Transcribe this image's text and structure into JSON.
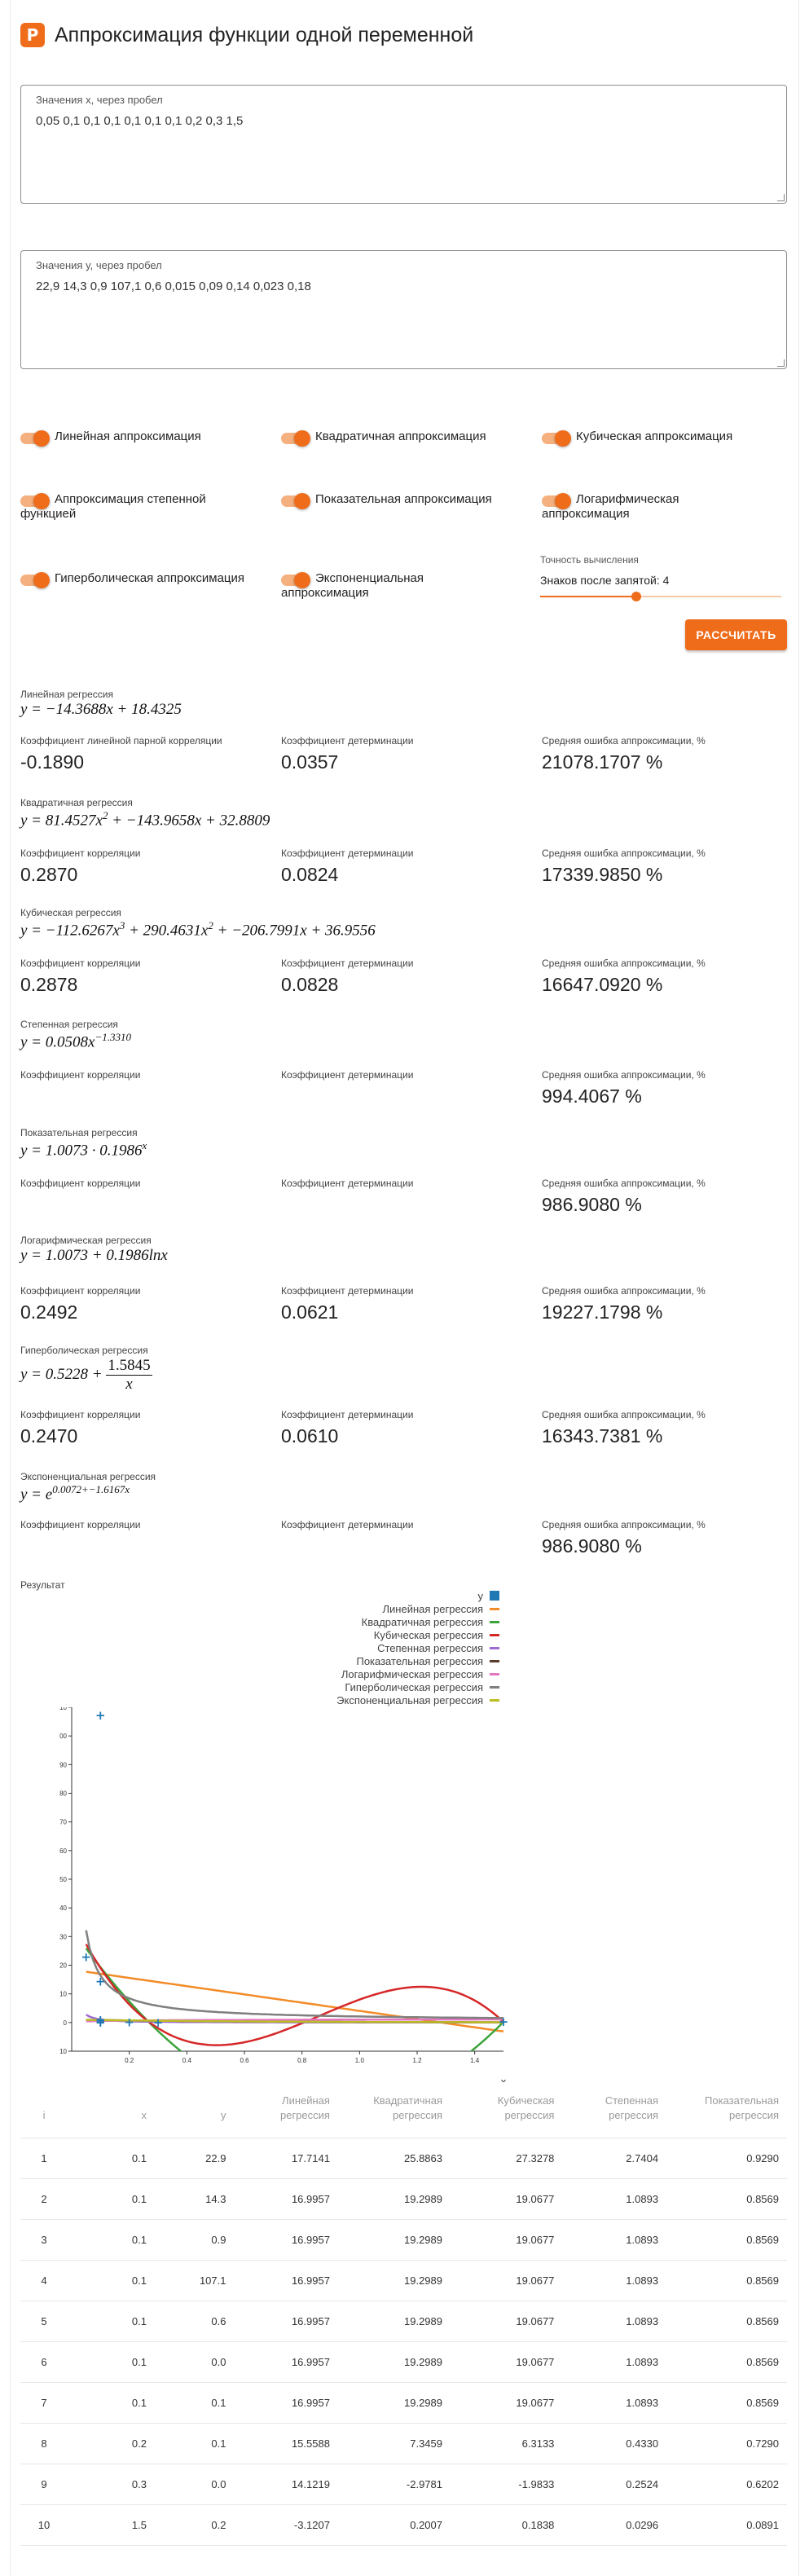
{
  "app": {
    "title": "Аппроксимация функции одной переменной",
    "logo_letter": "P"
  },
  "inputs": {
    "x": {
      "label": "Значения x, через пробел",
      "value": "0,05 0,1 0,1 0,1 0,1 0,1 0,1 0,2 0,3 1,5"
    },
    "y": {
      "label": "Значения y, через пробел",
      "value": "22,9 14,3 0,9 107,1 0,6 0,015 0,09 0,14 0,023 0,18"
    }
  },
  "toggles": [
    {
      "label": "Линейная аппроксимация",
      "on": true
    },
    {
      "label": "Квадратичная аппроксимация",
      "on": true
    },
    {
      "label": "Кубическая аппроксимация",
      "on": true
    },
    {
      "label": "Аппроксимация степенной функцией",
      "on": true
    },
    {
      "label": "Показательная аппроксимация",
      "on": true
    },
    {
      "label": "Логарифмическая аппроксимация",
      "on": true
    },
    {
      "label": "Гиперболическая аппроксимация",
      "on": true
    },
    {
      "label": "Экспоненциальная аппроксимация",
      "on": true
    }
  ],
  "precision": {
    "caption": "Точность вычисления",
    "value_text": "Знаков после запятой: 4",
    "value": 4,
    "slider_fraction": 0.4
  },
  "calc_button": "РАССЧИТАТЬ",
  "regressions": [
    {
      "title": "Линейная регрессия",
      "formula": "y = −14.3688x + 18.4325",
      "labels": [
        "Коэффициент линейной парной корреляции",
        "Коэффициент детерминации",
        "Средняя ошибка аппроксимации, %"
      ],
      "values": [
        "-0.1890",
        "0.0357",
        "21078.1707 %"
      ]
    },
    {
      "title": "Квадратичная регрессия",
      "formula": "y = 81.4527x² + −143.9658x + 32.8809",
      "labels": [
        "Коэффициент корреляции",
        "Коэффициент детерминации",
        "Средняя ошибка аппроксимации, %"
      ],
      "values": [
        "0.2870",
        "0.0824",
        "17339.9850 %"
      ]
    },
    {
      "title": "Кубическая регрессия",
      "formula": "y = −112.6267x³ + 290.4631x² + −206.7991x + 36.9556",
      "labels": [
        "Коэффициент корреляции",
        "Коэффициент детерминации",
        "Средняя ошибка аппроксимации, %"
      ],
      "values": [
        "0.2878",
        "0.0828",
        "16647.0920 %"
      ]
    },
    {
      "title": "Степенная регрессия",
      "formula": "y = 0.0508x^−1.3310",
      "labels": [
        "Коэффициент корреляции",
        "Коэффициент детерминации",
        "Средняя ошибка аппроксимации, %"
      ],
      "values": [
        "",
        "",
        "994.4067 %"
      ]
    },
    {
      "title": "Показательная регрессия",
      "formula": "y = 1.0073 · 0.1986^x",
      "labels": [
        "Коэффициент корреляции",
        "Коэффициент детерминации",
        "Средняя ошибка аппроксимации, %"
      ],
      "values": [
        "",
        "",
        "986.9080 %"
      ]
    },
    {
      "title": "Логарифмическая регрессия",
      "formula": "y = 1.0073 + 0.1986lnx",
      "labels": [
        "Коэффициент корреляции",
        "Коэффициент детерминации",
        "Средняя ошибка аппроксимации, %"
      ],
      "values": [
        "0.2492",
        "0.0621",
        "19227.1798 %"
      ]
    },
    {
      "title": "Гиперболическая регрессия",
      "formula": "y = 0.5228 + 1.5845/x",
      "labels": [
        "Коэффициент корреляции",
        "Коэффициент детерминации",
        "Средняя ошибка аппроксимации, %"
      ],
      "values": [
        "0.2470",
        "0.0610",
        "16343.7381 %"
      ]
    },
    {
      "title": "Экспоненциальная регрессия",
      "formula": "y = e^(0.0072+−1.6167x)",
      "labels": [
        "Коэффициент корреляции",
        "Коэффициент детерминации",
        "Средняя ошибка аппроксимации, %"
      ],
      "values": [
        "",
        "",
        "986.9080 %"
      ]
    }
  ],
  "formula_parts": {
    "r2_exp": "2",
    "r3_exp": "3",
    "r4_exp": "−1.3310",
    "r5_exp": "x",
    "r7_num": "1.5845",
    "r7_den": "x",
    "r8_exp": "0.0072+−1.6167x",
    "r1": "y = −14.3688x + 18.4325",
    "r2_a": "y = 81.4527x",
    "r2_b": " + −143.9658x + 32.8809",
    "r3_a": "y = −112.6267x",
    "r3_b": " + 290.4631x",
    "r3_c": " + −206.7991x + 36.9556",
    "r4_a": "y = 0.0508x",
    "r5_a": "y = 1.0073 · 0.1986",
    "r6": "y = 1.0073 + 0.1986lnx",
    "r7_a": "y = 0.5228 + ",
    "r8_a": "y = e"
  },
  "result_label": "Результат",
  "colors": {
    "accent": "#ef6c1a",
    "points": "#1f77b4"
  },
  "chart_data": {
    "type": "scatter",
    "xlabel": "x",
    "ylabel": "",
    "xlim": [
      0,
      1.5
    ],
    "ylim": [
      -10,
      110
    ],
    "xticks": [
      "0.2",
      "0.4",
      "0.6",
      "0.8",
      "1.0",
      "1.2",
      "1.4"
    ],
    "yticks": [
      "-10",
      "0",
      "10",
      "20",
      "30",
      "40",
      "50",
      "60",
      "70",
      "80",
      "90",
      "100",
      "110"
    ],
    "points": {
      "name": "y",
      "color": "#1f77b4",
      "x": [
        0.05,
        0.1,
        0.1,
        0.1,
        0.1,
        0.1,
        0.1,
        0.2,
        0.3,
        1.5
      ],
      "y": [
        22.9,
        14.3,
        0.9,
        107.1,
        0.6,
        0.015,
        0.09,
        0.14,
        0.023,
        0.18
      ]
    },
    "series": [
      {
        "name": "Линейная регрессия",
        "color": "#f28c28",
        "kind": "linear",
        "a": -14.3688,
        "b": 18.4325
      },
      {
        "name": "Квадратичная регрессия",
        "color": "#3aa33a",
        "kind": "quadratic",
        "a": 81.4527,
        "b": -143.9658,
        "c": 32.8809
      },
      {
        "name": "Кубическая регрессия",
        "color": "#d62728",
        "kind": "cubic",
        "a": -112.6267,
        "b": 290.4631,
        "c": -206.7991,
        "d": 36.9556
      },
      {
        "name": "Степенная регрессия",
        "color": "#9c6bcf",
        "kind": "power",
        "a": 0.0508,
        "b": -1.331
      },
      {
        "name": "Показательная регрессия",
        "color": "#5a3b2a",
        "kind": "exp_base",
        "a": 1.0073,
        "b": 0.1986
      },
      {
        "name": "Логарифмическая регрессия",
        "color": "#e377c2",
        "kind": "log",
        "a": 1.0073,
        "b": 0.1986
      },
      {
        "name": "Гиперболическая регрессия",
        "color": "#7f7f7f",
        "kind": "hyper",
        "a": 0.5228,
        "b": 1.5845
      },
      {
        "name": "Экспоненциальная регрессия",
        "color": "#bcbd22",
        "kind": "exp_e",
        "a": 0.0072,
        "b": -1.6167
      }
    ]
  },
  "table": {
    "headers": [
      "i",
      "x",
      "y",
      "Линейная регрессия",
      "Квадратичная регрессия",
      "Кубическая регрессия",
      "Степенная регрессия",
      "Показательная регрессия"
    ],
    "rows": [
      [
        "1",
        "0.1",
        "22.9",
        "17.7141",
        "25.8863",
        "27.3278",
        "2.7404",
        "0.9290"
      ],
      [
        "2",
        "0.1",
        "14.3",
        "16.9957",
        "19.2989",
        "19.0677",
        "1.0893",
        "0.8569"
      ],
      [
        "3",
        "0.1",
        "0.9",
        "16.9957",
        "19.2989",
        "19.0677",
        "1.0893",
        "0.8569"
      ],
      [
        "4",
        "0.1",
        "107.1",
        "16.9957",
        "19.2989",
        "19.0677",
        "1.0893",
        "0.8569"
      ],
      [
        "5",
        "0.1",
        "0.6",
        "16.9957",
        "19.2989",
        "19.0677",
        "1.0893",
        "0.8569"
      ],
      [
        "6",
        "0.1",
        "0.0",
        "16.9957",
        "19.2989",
        "19.0677",
        "1.0893",
        "0.8569"
      ],
      [
        "7",
        "0.1",
        "0.1",
        "16.9957",
        "19.2989",
        "19.0677",
        "1.0893",
        "0.8569"
      ],
      [
        "8",
        "0.2",
        "0.1",
        "15.5588",
        "7.3459",
        "6.3133",
        "0.4330",
        "0.7290"
      ],
      [
        "9",
        "0.3",
        "0.0",
        "14.1219",
        "-2.9781",
        "-1.9833",
        "0.2524",
        "0.6202"
      ],
      [
        "10",
        "1.5",
        "0.2",
        "-3.1207",
        "0.2007",
        "0.1838",
        "0.0296",
        "0.0891"
      ]
    ]
  }
}
